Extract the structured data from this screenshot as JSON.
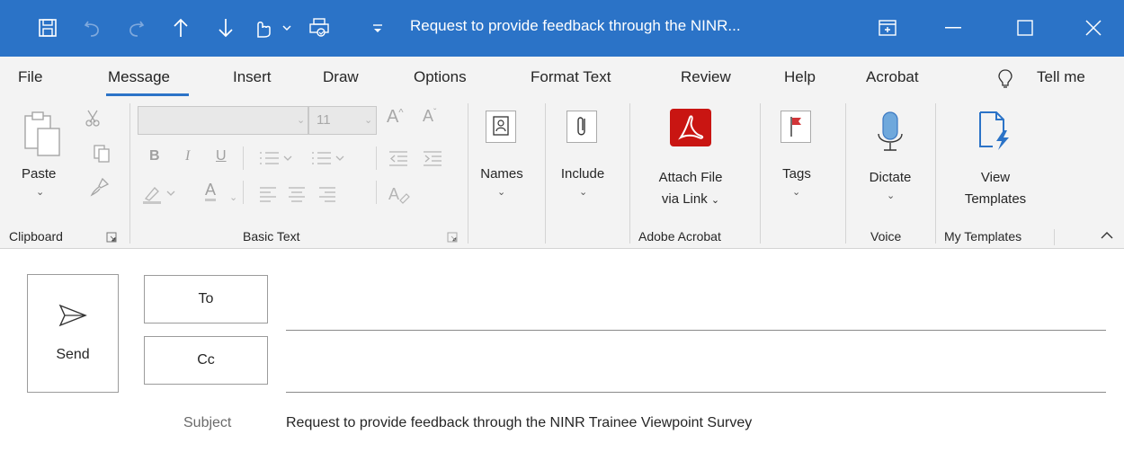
{
  "window": {
    "title": "Request to provide feedback through the NINR...",
    "accent_color": "#2b73c7"
  },
  "quick_access": [
    {
      "icon": "save-icon"
    },
    {
      "icon": "undo-icon"
    },
    {
      "icon": "redo-icon"
    },
    {
      "icon": "arrow-up-icon"
    },
    {
      "icon": "arrow-down-icon"
    },
    {
      "icon": "touch-mode-icon"
    },
    {
      "icon": "customize-icon"
    }
  ],
  "menu": {
    "items": [
      "File",
      "Message",
      "Insert",
      "Draw",
      "Options",
      "Format Text",
      "Review",
      "Help",
      "Acrobat"
    ],
    "active": "Message",
    "tell_me": "Tell me"
  },
  "ribbon": {
    "clipboard": {
      "paste_label": "Paste",
      "group_name": "Clipboard"
    },
    "basic_text": {
      "font_size": "11",
      "bold": "B",
      "italic": "I",
      "underline": "U",
      "font_color": "A",
      "group_name": "Basic Text"
    },
    "names": {
      "label": "Names"
    },
    "include": {
      "label": "Include"
    },
    "attach": {
      "line1": "Attach File",
      "line2": "via Link",
      "group_name": "Adobe Acrobat"
    },
    "tags": {
      "label": "Tags"
    },
    "dictate": {
      "label": "Dictate",
      "group_name": "Voice"
    },
    "templates": {
      "line1": "View",
      "line2": "Templates",
      "group_name": "My Templates"
    }
  },
  "compose": {
    "send_label": "Send",
    "to_label": "To",
    "cc_label": "Cc",
    "subject_label": "Subject",
    "subject_value": "Request to provide feedback through the NINR Trainee Viewpoint Survey"
  }
}
